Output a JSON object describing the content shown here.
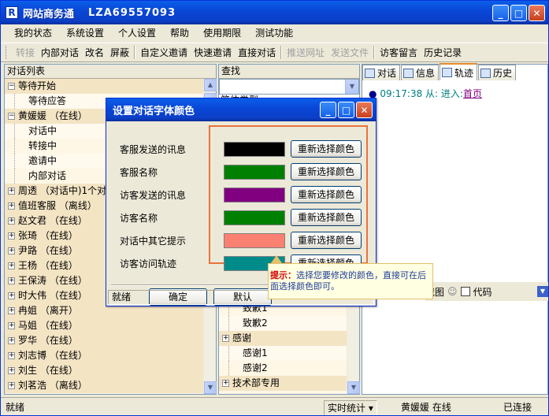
{
  "window": {
    "title": "网站商务通",
    "account_id": "LZA69557093",
    "btn_minimize": "_",
    "btn_maximize": "□",
    "btn_close": "✕"
  },
  "menu": [
    "我的状态",
    "系统设置",
    "个人设置",
    "帮助",
    "使用期限",
    "测试功能"
  ],
  "toolbar": [
    {
      "label": "转接",
      "enabled": false
    },
    {
      "label": "内部对话",
      "enabled": true
    },
    {
      "label": "改名",
      "enabled": true
    },
    {
      "label": "屏蔽",
      "enabled": true
    },
    {
      "sep": true
    },
    {
      "label": "自定义邀请",
      "enabled": true
    },
    {
      "label": "快速邀请",
      "enabled": true
    },
    {
      "label": "直接对话",
      "enabled": true
    },
    {
      "sep": true
    },
    {
      "label": "推送网址",
      "enabled": false
    },
    {
      "label": "发送文件",
      "enabled": false
    },
    {
      "sep": true
    },
    {
      "label": "访客留言",
      "enabled": true
    },
    {
      "label": "历史记录",
      "enabled": true
    }
  ],
  "left_panel": {
    "title": "对话列表",
    "rows": [
      {
        "type": "group",
        "label": "等待开始",
        "expanded": true
      },
      {
        "type": "child",
        "label": "等待应答"
      },
      {
        "type": "group",
        "label": "黄媛媛 （在线）",
        "expanded": true
      },
      {
        "type": "child",
        "label": "对话中"
      },
      {
        "type": "child",
        "label": "转接中"
      },
      {
        "type": "child",
        "label": "邀请中"
      },
      {
        "type": "child",
        "label": "内部对话"
      },
      {
        "type": "group",
        "label": "周透 （对话中)1个对话",
        "expanded": false
      },
      {
        "type": "group",
        "label": "值班客服 （离线）",
        "expanded": false
      },
      {
        "type": "group",
        "label": "赵文君 （在线）",
        "expanded": false
      },
      {
        "type": "group",
        "label": "张琦 （在线）",
        "expanded": false
      },
      {
        "type": "group",
        "label": "尹路 （在线）",
        "expanded": false
      },
      {
        "type": "group",
        "label": "王杨 （在线）",
        "expanded": false
      },
      {
        "type": "group",
        "label": "王保涛 （在线）",
        "expanded": false
      },
      {
        "type": "group",
        "label": "时大伟 （在线）",
        "expanded": false
      },
      {
        "type": "group",
        "label": "冉姐 （离开）",
        "expanded": false
      },
      {
        "type": "group",
        "label": "马姐 （在线）",
        "expanded": false
      },
      {
        "type": "group",
        "label": "罗华 （在线）",
        "expanded": false
      },
      {
        "type": "group",
        "label": "刘志博 （在线）",
        "expanded": false
      },
      {
        "type": "group",
        "label": "刘生 （在线）",
        "expanded": false
      },
      {
        "type": "group",
        "label": "刘茗浩 （离线）",
        "expanded": false
      }
    ]
  },
  "middle_panel": {
    "search_label": "查找",
    "header_peek": "简体类型",
    "rows": [
      {
        "type": "child",
        "label": "致歉1"
      },
      {
        "type": "child",
        "label": "致歉2"
      },
      {
        "type": "group",
        "label": "感谢"
      },
      {
        "type": "child",
        "label": "感谢1"
      },
      {
        "type": "child",
        "label": "感谢2"
      },
      {
        "type": "group",
        "label": "技术部专用"
      }
    ]
  },
  "right_panel": {
    "tabs": [
      {
        "label": "对话",
        "active": false
      },
      {
        "label": "信息",
        "active": false
      },
      {
        "label": "轨迹",
        "active": true
      },
      {
        "label": "历史",
        "active": false
      }
    ],
    "log": {
      "time": "09:17:38",
      "from": "从:",
      "action": "进入:",
      "link": "首页"
    },
    "bottom_tools": [
      "截图",
      "代码"
    ]
  },
  "dialog": {
    "title": "设置对话字体颜色",
    "rows": [
      {
        "label": "客服发送的讯息",
        "color": "#000000",
        "button": "重新选择颜色"
      },
      {
        "label": "客服名称",
        "color": "#008000",
        "button": "重新选择颜色"
      },
      {
        "label": "访客发送的讯息",
        "color": "#800080",
        "button": "重新选择颜色"
      },
      {
        "label": "访客名称",
        "color": "#008000",
        "button": "重新选择颜色"
      },
      {
        "label": "对话中其它提示",
        "color": "#fa8072",
        "button": "重新选择颜色"
      },
      {
        "label": "访客访问轨迹",
        "color": "#008b8b",
        "button": "重新选择颜色"
      }
    ],
    "ok_label": "确定",
    "default_label": "默认",
    "status_text": "就绪",
    "tip_title": "提示：",
    "tip_text": "选择您要修改的颜色，直接可在后面选择颜色即可。"
  },
  "statusbar": {
    "left": "就绪",
    "stats": "实时统计",
    "user": "黄媛媛 在线",
    "connection": "已连接"
  }
}
